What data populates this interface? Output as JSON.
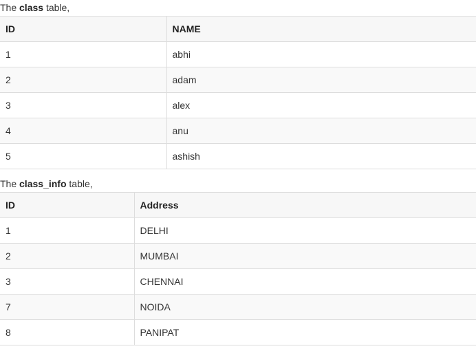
{
  "section1": {
    "prefix": "The ",
    "table_name": "class",
    "suffix": " table,",
    "columns": [
      "ID",
      "NAME"
    ],
    "rows": [
      [
        "1",
        "abhi"
      ],
      [
        "2",
        "adam"
      ],
      [
        "3",
        "alex"
      ],
      [
        "4",
        "anu"
      ],
      [
        "5",
        "ashish"
      ]
    ]
  },
  "section2": {
    "prefix": "The ",
    "table_name": "class_info",
    "suffix": " table,",
    "columns": [
      "ID",
      "Address"
    ],
    "rows": [
      [
        "1",
        "DELHI"
      ],
      [
        "2",
        "MUMBAI"
      ],
      [
        "3",
        "CHENNAI"
      ],
      [
        "7",
        "NOIDA"
      ],
      [
        "8",
        "PANIPAT"
      ]
    ]
  }
}
